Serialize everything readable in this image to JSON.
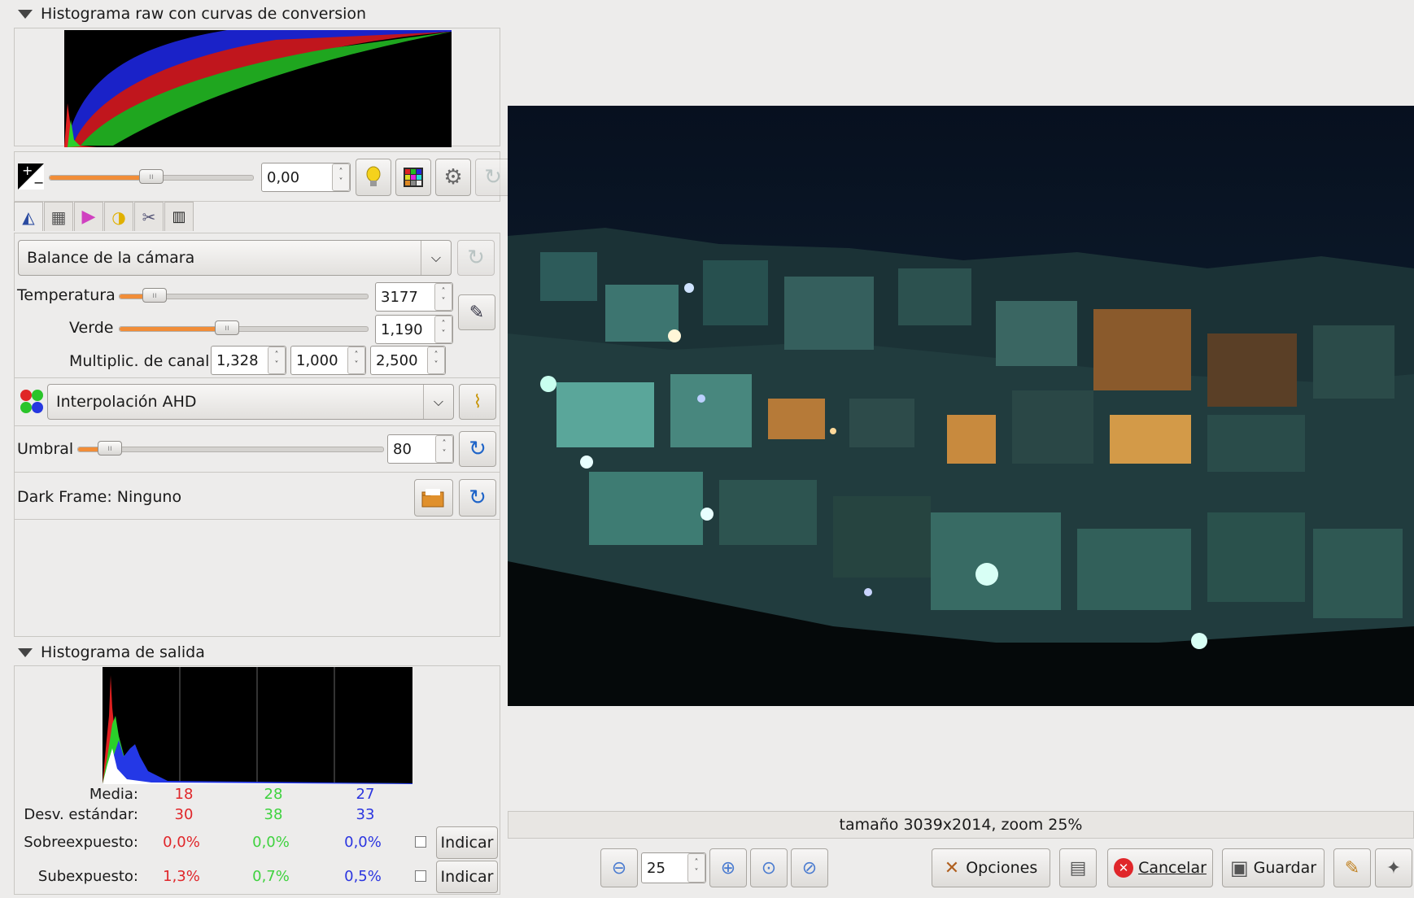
{
  "raw_histogram": {
    "title": "Histograma raw con curvas de conversion"
  },
  "exposure": {
    "value": "0,00",
    "level_fraction": 0.5
  },
  "tabs": [
    "white-balance",
    "curves",
    "color-management",
    "lightness",
    "crop",
    "exif"
  ],
  "white_balance": {
    "preset": "Balance de la cámara",
    "temperatura_label": "Temperatura",
    "temperatura_value": "3177",
    "verde_label": "Verde",
    "verde_value": "1,190",
    "multiplic_label": "Multiplic. de canal:",
    "mult_r": "1,328",
    "mult_g": "1,000",
    "mult_b": "2,500"
  },
  "interpolation": {
    "value": "Interpolación AHD"
  },
  "umbral": {
    "label": "Umbral",
    "value": "80"
  },
  "dark_frame": {
    "label": "Dark Frame: Ninguno"
  },
  "output_histogram": {
    "title": "Histograma de salida",
    "media_label": "Media:",
    "media": [
      "18",
      "28",
      "27"
    ],
    "desv_label": "Desv. estándar:",
    "desv": [
      "30",
      "38",
      "33"
    ],
    "sobre_label": "Sobreexpuesto:",
    "sobre": [
      "0,0%",
      "0,0%",
      "0,0%"
    ],
    "sub_label": "Subexpuesto:",
    "sub": [
      "1,3%",
      "0,7%",
      "0,5%"
    ],
    "indicar_label": "Indicar"
  },
  "status": {
    "text": "tamaño 3039x2014, zoom 25%"
  },
  "zoom": {
    "value": "25"
  },
  "buttons": {
    "opciones": "Opciones",
    "cancelar": "Cancelar",
    "guardar": "Guardar"
  },
  "colors": {
    "accent_orange": "#f18d38",
    "red": "#e0262a",
    "green": "#3fd23f",
    "blue": "#2b35e0"
  }
}
